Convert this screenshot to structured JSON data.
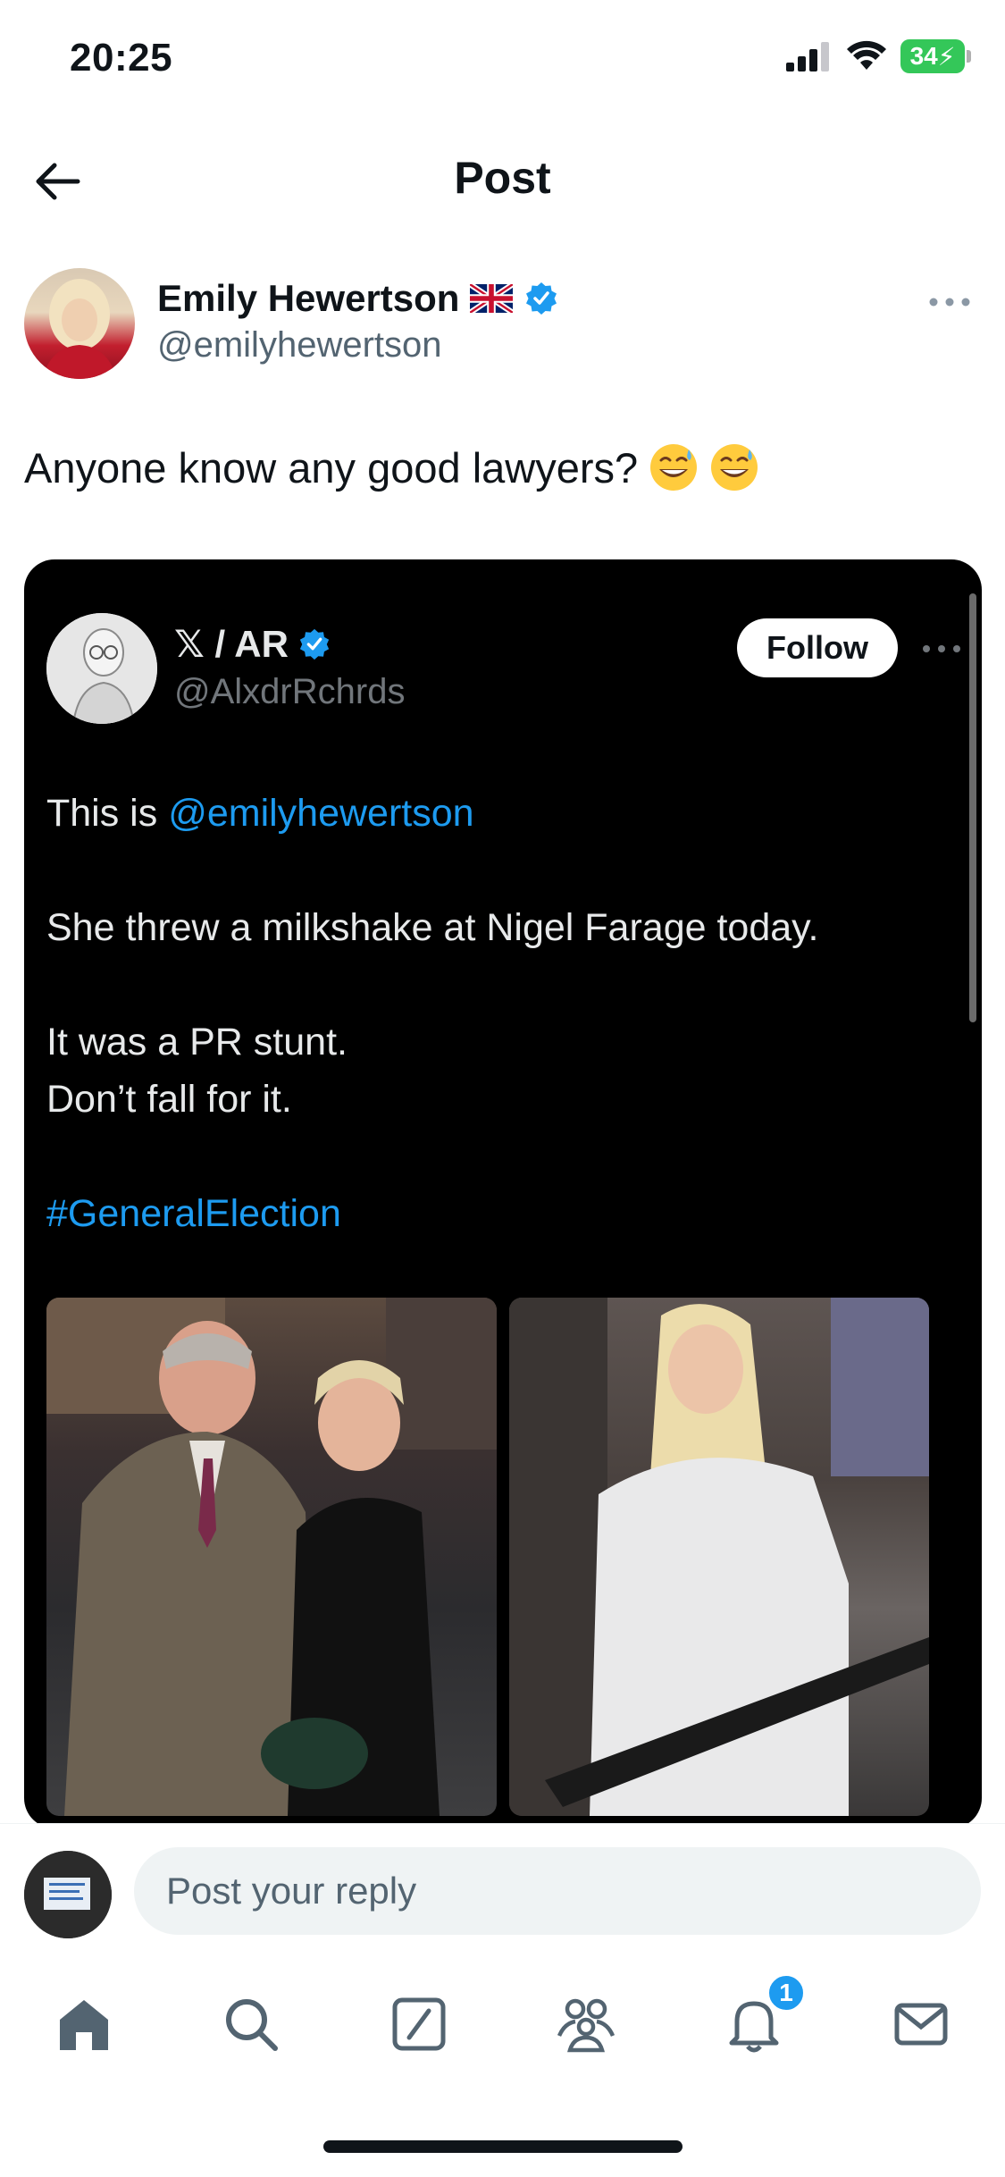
{
  "status_bar": {
    "time": "20:25",
    "battery": "34"
  },
  "header": {
    "title": "Post"
  },
  "post": {
    "author_name": "Emily Hewertson",
    "author_handle": "@emilyhewertson",
    "text": "Anyone know any good lawyers?"
  },
  "quoted_post": {
    "author_name": "𝕏 / AR",
    "author_handle": "@AlxdrRchrds",
    "follow_label": "Follow",
    "line1_prefix": "This is ",
    "line1_mention": "@emilyhewertson",
    "line2": "She threw a milkshake at Nigel Farage today.",
    "line3": "It was a PR stunt.",
    "line4": "Don’t fall for it.",
    "hashtag": "#GeneralElection"
  },
  "reply": {
    "placeholder": "Post your reply"
  },
  "tabs": {
    "notifications_badge": "1"
  },
  "colors": {
    "accent": "#1d9bf0",
    "verified": "#1d9bf0",
    "battery": "#34c759"
  }
}
